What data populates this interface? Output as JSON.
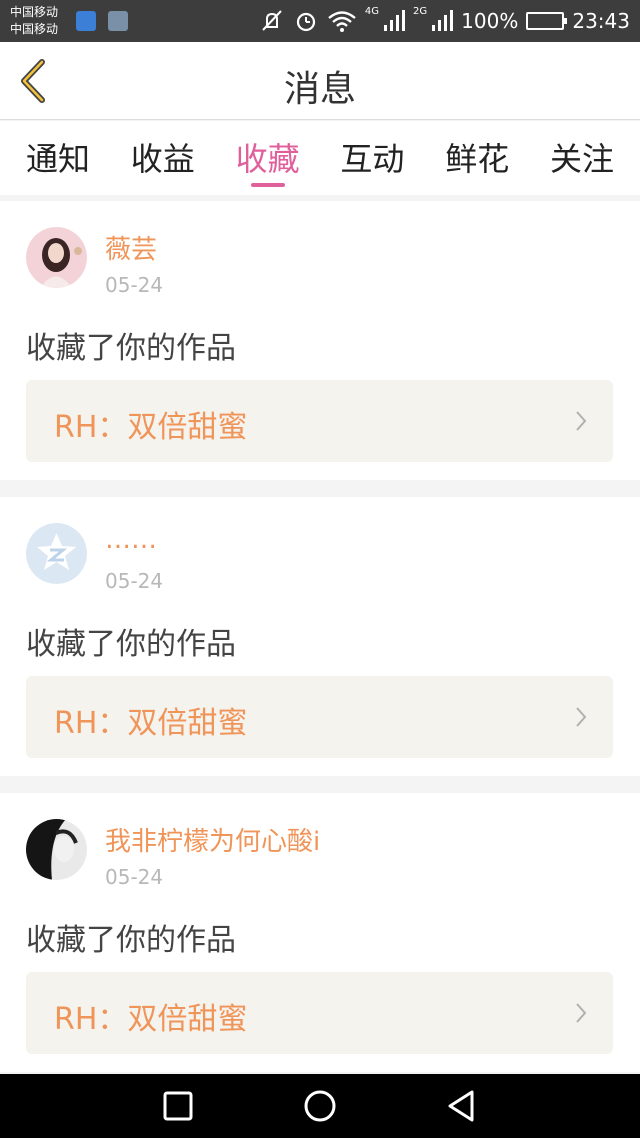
{
  "status_bar": {
    "carrier_1": "中国移动",
    "carrier_2": "中国移动",
    "network_1": "4G",
    "network_2": "2G",
    "battery": "100%",
    "time": "23:43",
    "icons": [
      "app-notification-icon",
      "image-notification-icon",
      "mute-icon",
      "alarm-icon",
      "wifi-icon",
      "signal-icon",
      "battery-icon"
    ]
  },
  "header": {
    "title": "消息",
    "back_icon": "chevron-left-icon"
  },
  "tabs": [
    {
      "label": "通知",
      "active": false
    },
    {
      "label": "收益",
      "active": false
    },
    {
      "label": "收藏",
      "active": true
    },
    {
      "label": "互动",
      "active": false
    },
    {
      "label": "鲜花",
      "active": false
    },
    {
      "label": "关注",
      "active": false
    }
  ],
  "messages": [
    {
      "user": "薇芸",
      "time": "05-24",
      "action": "收藏了你的作品",
      "work": "RH：双倍甜蜜"
    },
    {
      "user": "……",
      "time": "05-24",
      "action": "收藏了你的作品",
      "work": "RH：双倍甜蜜"
    },
    {
      "user": "我非柠檬为何心酸i",
      "time": "05-24",
      "action": "收藏了你的作品",
      "work": "RH：双倍甜蜜"
    }
  ],
  "colors": {
    "accent": "#e0609c",
    "username": "#f0955a",
    "work_bg": "#f5f3ee"
  },
  "nav_bar": {
    "icons": [
      "recent-apps-icon",
      "home-icon",
      "back-icon"
    ]
  }
}
